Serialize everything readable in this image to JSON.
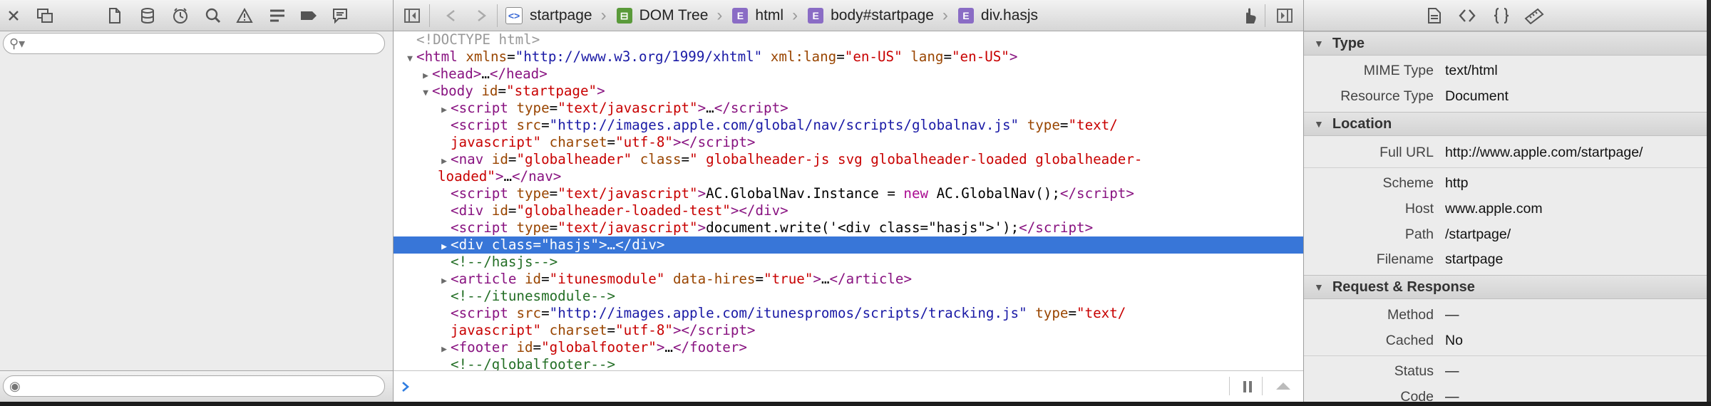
{
  "left": {
    "toolbar_icons": [
      "close-icon",
      "detach-icon",
      "resources-icon",
      "storage-icon",
      "timeline-icon",
      "search-icon",
      "issues-icon",
      "debugger-icon",
      "log-icon",
      "console-icon"
    ],
    "search_placeholder": "",
    "bottom_search_placeholder": ""
  },
  "breadcrumbs": [
    {
      "label": "startpage",
      "icon": "document-icon",
      "icon_glyph": "<>"
    },
    {
      "label": "DOM Tree",
      "icon": "dom-tree-icon",
      "icon_glyph": "⊟"
    },
    {
      "label": "html",
      "icon": "element-icon",
      "icon_glyph": "E"
    },
    {
      "label": "body#startpage",
      "icon": "element-icon",
      "icon_glyph": "E"
    },
    {
      "label": "div.hasjs",
      "icon": "element-icon",
      "icon_glyph": "E"
    }
  ],
  "code": {
    "doctype": "<!DOCTYPE html>",
    "l1_tag": "html",
    "l1_a1": "xmlns",
    "l1_v1": "\"http://www.w3.org/1999/xhtml\"",
    "l1_a2": "xml:lang",
    "l1_v2": "\"en-US\"",
    "l1_a3": "lang",
    "l1_v3": "\"en-US\"",
    "l2": "head",
    "l2_ell": "…",
    "l3_tag": "body",
    "l3_a": "id",
    "l3_v": "\"startpage\"",
    "l4_tag": "script",
    "l4_a": "type",
    "l4_v": "\"text/javascript\"",
    "l5_a1": "src",
    "l5_v1": "\"http://images.apple.com/global/nav/scripts/globalnav.js\"",
    "l5_a2": "type",
    "l5_v2a": "\"text/",
    "l6_v2b": "javascript\"",
    "l6_a3": "charset",
    "l6_v3": "\"utf-8\"",
    "l7_tag": "nav",
    "l7_a1": "id",
    "l7_v1": "\"globalheader\"",
    "l7_a2": "class",
    "l7_v2a": "\" globalheader-js svg globalheader-loaded globalheader-",
    "l8_v2b": "loaded\"",
    "l9_text": "AC.GlobalNav.Instance = ",
    "l9_kw": "new",
    "l9_text2": " AC.GlobalNav();",
    "l10_tag": "div",
    "l10_a": "id",
    "l10_v": "\"globalheader-loaded-test\"",
    "l11_text": "document.write('<div class=\"hasjs\">');",
    "l12_a": "class",
    "l12_v": "\"hasjs\"",
    "l13_comment": "<!--/hasjs-->",
    "l14_tag": "article",
    "l14_a1": "id",
    "l14_v1": "\"itunesmodule\"",
    "l14_a2": "data-hires",
    "l14_v2": "\"true\"",
    "l15_comment": "<!--/itunesmodule-->",
    "l16_v1": "\"http://images.apple.com/itunespromos/scripts/tracking.js\"",
    "l18_tag": "footer",
    "l18_a": "id",
    "l18_v": "\"globalfooter\"",
    "l19_comment": "<!--/globalfooter-->"
  },
  "details": {
    "type_header": "Type",
    "mime_label": "MIME Type",
    "mime_value": "text/html",
    "resource_label": "Resource Type",
    "resource_value": "Document",
    "location_header": "Location",
    "url_label": "Full URL",
    "url_value": "http://www.apple.com/startpage/",
    "scheme_label": "Scheme",
    "scheme_value": "http",
    "host_label": "Host",
    "host_value": "www.apple.com",
    "path_label": "Path",
    "path_value": "/startpage/",
    "filename_label": "Filename",
    "filename_value": "startpage",
    "rr_header": "Request & Response",
    "method_label": "Method",
    "method_value": "—",
    "cached_label": "Cached",
    "cached_value": "No",
    "status_label": "Status",
    "status_value": "—",
    "code_label": "Code",
    "code_value": "—"
  },
  "colors": {
    "selection": "#3876d8",
    "tag": "#881280",
    "attr": "#994500",
    "value": "#1a1aa6",
    "comment": "#236e25"
  }
}
